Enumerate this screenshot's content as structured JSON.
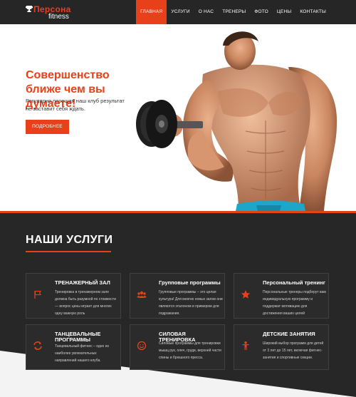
{
  "brand": {
    "main": "Персона",
    "sub": "fitness"
  },
  "nav": [
    {
      "label": "ГЛАВНАЯ",
      "active": true
    },
    {
      "label": "УСЛУГИ",
      "active": false
    },
    {
      "label": "О НАС",
      "active": false
    },
    {
      "label": "ТРЕНЕРЫ",
      "active": false
    },
    {
      "label": "ФОТО",
      "active": false
    },
    {
      "label": "ЦЕНЫ",
      "active": false
    },
    {
      "label": "КОНТАКТЫ",
      "active": false
    }
  ],
  "hero": {
    "title": "Совершенство ближе чем вы думаете!",
    "text": "Регулярно посещая наш клуб результат не заставит себя ждать.",
    "button": "ПОДРОБНЕЕ"
  },
  "services": {
    "title": "НАШИ УСЛУГИ",
    "cards": [
      {
        "title": "ТРЕНАЖЕРНЫЙ ЗАЛ",
        "text": "Тренировка в тренажерном зале должна быть разумной по стоимости — вопрос цены играет для многих одну важную роль",
        "icon": "flag-icon"
      },
      {
        "title": "Групповые программы",
        "text": "Групповые программы – это целая культура! Для многих новых залов они являются эталоном и примером для подражания.",
        "icon": "group-icon"
      },
      {
        "title": "Персональный тренинг",
        "text": "Персональные тренеры подберут вам индивидуальную программу и поддержат мотивацию для достижения ваших целей",
        "icon": "star-icon"
      },
      {
        "title": "ТАНЦЕВАЛЬНЫЕ ПРОГРАММЫ",
        "text": "Танцевальный фитнес – одно из наиболее увлекательных направлений нашего клуба.",
        "icon": "refresh-icon"
      },
      {
        "title": "СИЛОВАЯ ТРЕНИРОВКА",
        "text": "Силовые программы для тренировки мышц рук, плеч, груди, верхней части спины и брюшного пресса.",
        "icon": "smile-icon"
      },
      {
        "title": "ДЕТСКИЕ ЗАНЯТИЯ",
        "text": "Широкий выбор программ для детей от 3 лет до 15 лет, включая фитнес-занятия и спортивные секции.",
        "icon": "child-icon"
      }
    ]
  },
  "colors": {
    "accent": "#e8401b",
    "dark": "#272727",
    "card_border": "#414141"
  }
}
